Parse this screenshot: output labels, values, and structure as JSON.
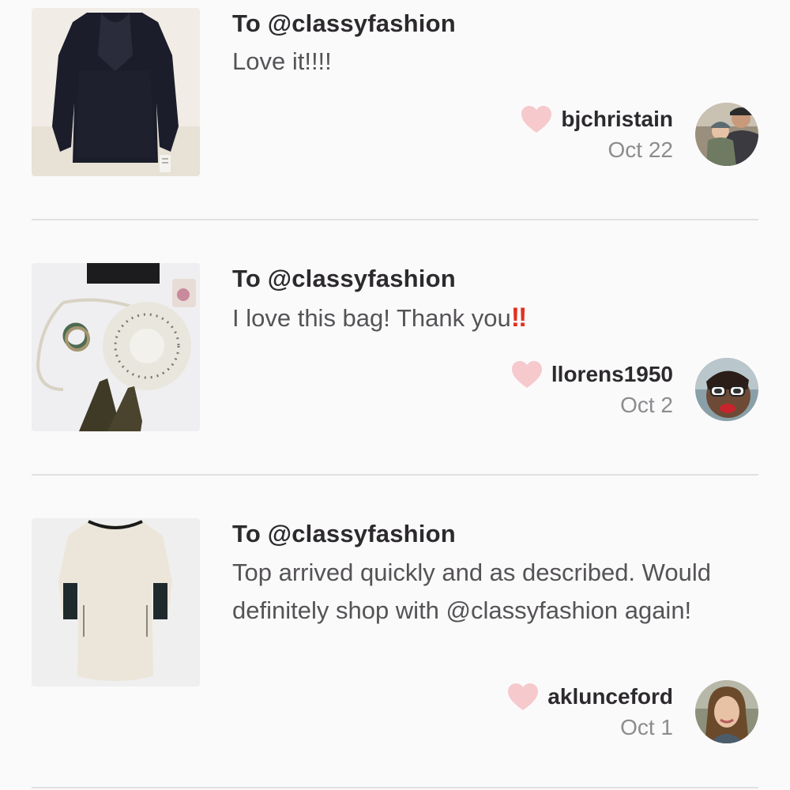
{
  "reviews": [
    {
      "to": "To @classyfashion",
      "comment": "Love it!!!!",
      "comment_emoji": "",
      "username": "bjchristain",
      "date": "Oct 22",
      "item_image": "black-lace-blouse",
      "avatar_image": "man-with-baby"
    },
    {
      "to": "To @classyfashion",
      "comment": "I love this bag! Thank you",
      "comment_emoji": "‼",
      "username": "llorens1950",
      "date": "Oct 2",
      "item_image": "white-round-crossbody-bag",
      "avatar_image": "woman-with-sunglasses"
    },
    {
      "to": "To @classyfashion",
      "comment": "Top arrived quickly and as described. Would definitely shop with @classyfashion again!",
      "comment_emoji": "",
      "username": "aklunceford",
      "date": "Oct 1",
      "item_image": "cream-knit-sweater",
      "avatar_image": "woman-portrait"
    }
  ],
  "icons": {
    "like": "heart-icon"
  },
  "colors": {
    "heart": "#f6c9cd",
    "text_primary": "#2c2a2d",
    "text_secondary": "#555356",
    "date": "#8d8b8e",
    "emphasis": "#e3301f",
    "divider": "#e2e0e2",
    "background": "#fbfafb"
  }
}
